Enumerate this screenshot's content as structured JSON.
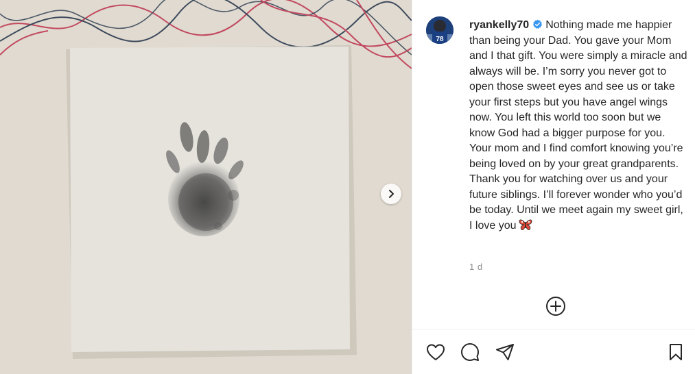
{
  "post": {
    "username": "ryankelly70",
    "verified": true,
    "caption": "Nothing made me happier than being your Dad. You gave your Mom and I that gift. You were simply a miracle and always will be. I’m sorry you never got to open those sweet eyes and see us or take your first steps but you have angel wings now. You left this world too soon but we know God had a bigger purpose for you. Your mom and I find comfort knowing you’re being loved on by your great grandparents. Thank you for watching over us and your future siblings. I’ll forever wonder who you’d be today. Until we meet again my sweet girl, I love you",
    "caption_emoji": "butterfly-emoji",
    "timestamp": "1 d",
    "avatar_jersey_number": "78"
  },
  "icons": {
    "verified": "verified-badge-icon",
    "next": "chevron-right-icon",
    "add_comment": "plus-circle-icon",
    "like": "heart-icon",
    "comment": "comment-bubble-icon",
    "share": "paper-plane-icon",
    "save": "bookmark-icon"
  },
  "colors": {
    "verified_blue": "#3897f0",
    "text": "#262626",
    "muted": "#8e8e8e",
    "divider": "#efefef"
  }
}
